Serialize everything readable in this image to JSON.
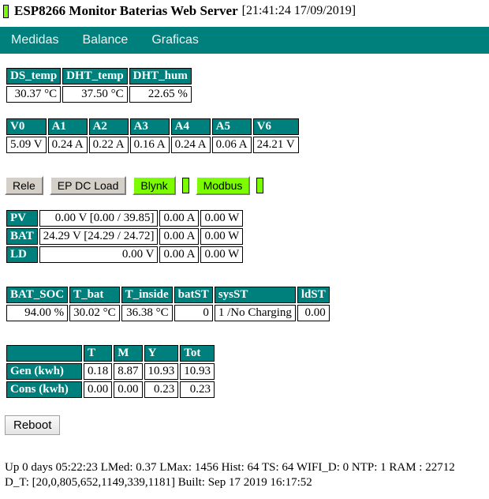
{
  "page": {
    "title": "ESP8266 Monitor Baterias Web Server",
    "timestamp": "[21:41:24 17/09/2019]",
    "status_led": "green"
  },
  "nav": {
    "items": [
      {
        "label": "Medidas"
      },
      {
        "label": "Balance"
      },
      {
        "label": "Graficas"
      }
    ]
  },
  "temp_table": {
    "headers": [
      "DS_temp",
      "DHT_temp",
      "DHT_hum"
    ],
    "values": [
      "30.37 °C",
      "37.50 °C",
      "22.65 %"
    ]
  },
  "channels_table": {
    "headers": [
      "V0",
      "A1",
      "A2",
      "A3",
      "A4",
      "A5",
      "V6"
    ],
    "values": [
      "5.09 V",
      "0.24 A",
      "0.22 A",
      "0.16 A",
      "0.24 A",
      "0.06 A",
      "24.21 V"
    ]
  },
  "buttons": {
    "rele": "Rele",
    "ep_dc_load": "EP DC Load",
    "blynk": "Blynk",
    "modbus": "Modbus",
    "reboot": "Reboot"
  },
  "power_table": {
    "rows": [
      {
        "label": "PV",
        "volt": "0.00 V [0.00 / 39.85]",
        "amp": "0.00 A",
        "watt": "0.00 W"
      },
      {
        "label": "BAT",
        "volt": "24.29 V [24.29 / 24.72]",
        "amp": "0.00 A",
        "watt": "0.00 W"
      },
      {
        "label": "LD",
        "volt": "0.00 V",
        "amp": "0.00 A",
        "watt": "0.00 W"
      }
    ]
  },
  "status_table": {
    "headers": [
      "BAT_SOC",
      "T_bat",
      "T_inside",
      "batST",
      "sysST",
      "ldST"
    ],
    "values": [
      "94.00 %",
      "30.02 °C",
      "36.38 °C",
      "0",
      "1 /No Charging",
      "0.00"
    ]
  },
  "energy_table": {
    "corner": "",
    "headers": [
      "T",
      "M",
      "Y",
      "Tot"
    ],
    "rows": [
      {
        "label": "Gen (kwh)",
        "values": [
          "0.18",
          "8.87",
          "10.93",
          "10.93"
        ]
      },
      {
        "label": "Cons (kwh)",
        "values": [
          "0.00",
          "0.00",
          "0.23",
          "0.23"
        ]
      }
    ]
  },
  "footer": {
    "line1": "Up 0 days 05:22:23 LMed: 0.37 LMax: 1456 Hist: 64 TS: 64 WIFI_D: 0 NTP: 1 RAM : 22712",
    "line2": "D_T: [20,0,805,652,1149,339,1181] Built: Sep 17 2019 16:17:52"
  },
  "colors": {
    "teal": "#00807d",
    "green": "#7cfc00",
    "button_gray": "#d4d0c8"
  }
}
